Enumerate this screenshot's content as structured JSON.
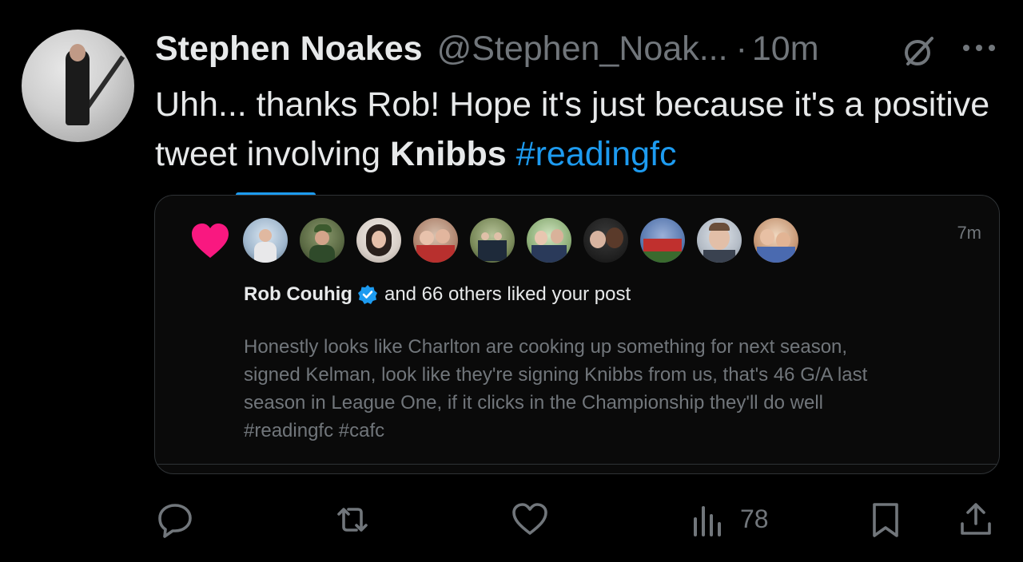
{
  "author": {
    "name": "Stephen Noakes",
    "handle": "@Stephen_Noak...",
    "separator": "·",
    "time": "10m"
  },
  "tweet": {
    "text_part1": "Uhh... thanks Rob! Hope it's just because it's a positive tweet involving ",
    "text_bold": "Knibbs",
    "text_space": " ",
    "hashtag": "#readingfc"
  },
  "card": {
    "time": "7m",
    "liker_name": "Rob Couhig",
    "liked_rest": "and 66 others liked your post",
    "quoted_text": "Honestly looks like Charlton are cooking up something for next season, signed Kelman, look like they're signing Knibbs from us, that's 46 G/A last season in League One, if it clicks in the Championship they'll do well #readingfc #cafc",
    "liker_avatars": [
      {
        "name": "liker-avatar-1"
      },
      {
        "name": "liker-avatar-2"
      },
      {
        "name": "liker-avatar-3"
      },
      {
        "name": "liker-avatar-4"
      },
      {
        "name": "liker-avatar-5"
      },
      {
        "name": "liker-avatar-6"
      },
      {
        "name": "liker-avatar-7"
      },
      {
        "name": "liker-avatar-8"
      },
      {
        "name": "liker-avatar-9"
      },
      {
        "name": "liker-avatar-10"
      }
    ]
  },
  "actions": {
    "views": "78",
    "icons": [
      "reply-icon",
      "retweet-icon",
      "like-icon",
      "views-icon",
      "bookmark-icon",
      "share-icon"
    ]
  },
  "colors": {
    "background": "#000000",
    "text": "#e7e9ea",
    "muted": "#71767b",
    "accent": "#1d9bf0",
    "heart": "#f91880",
    "border": "#2f3336"
  }
}
